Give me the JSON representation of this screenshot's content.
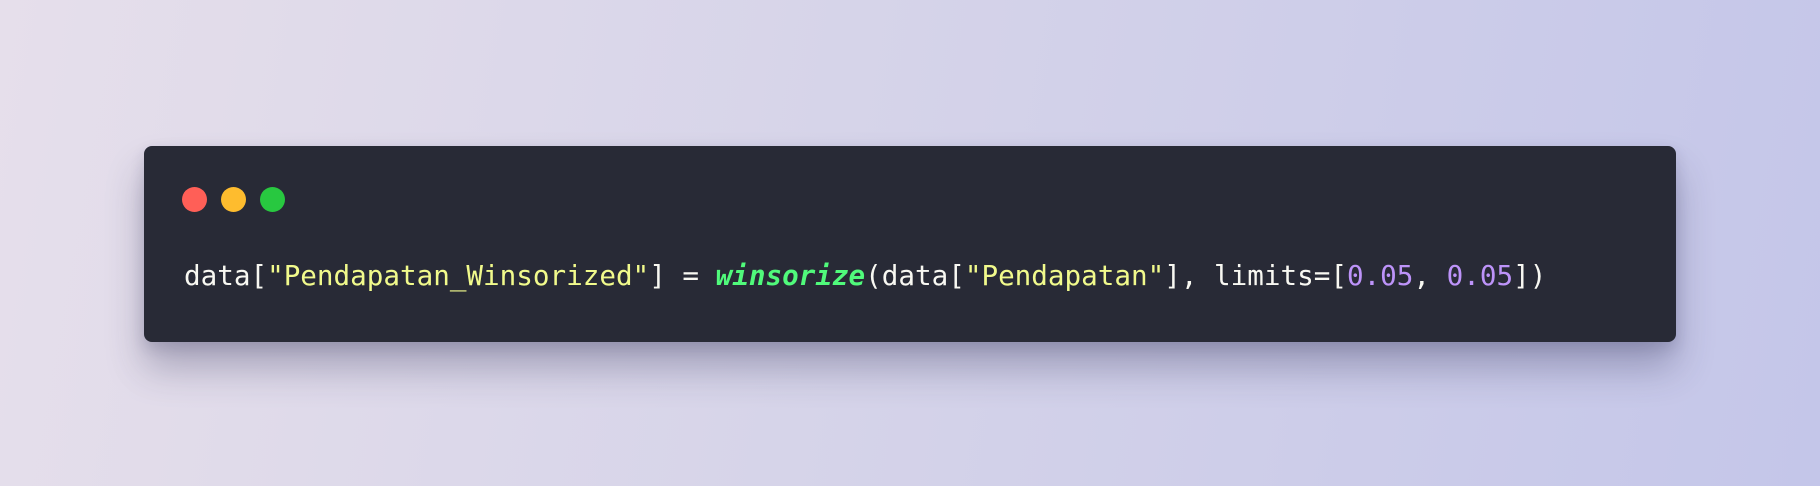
{
  "window": {
    "controls": [
      {
        "name": "close",
        "color": "#ff5f57"
      },
      {
        "name": "minimize",
        "color": "#febc2e"
      },
      {
        "name": "maximize",
        "color": "#28c840"
      }
    ]
  },
  "code": {
    "tokens": [
      {
        "text": "data[",
        "type": "plain"
      },
      {
        "text": "\"Pendapatan_Winsorized\"",
        "type": "str"
      },
      {
        "text": "] = ",
        "type": "plain"
      },
      {
        "text": "winsorize",
        "type": "fn"
      },
      {
        "text": "(data[",
        "type": "plain"
      },
      {
        "text": "\"Pendapatan\"",
        "type": "str"
      },
      {
        "text": "], limits=[",
        "type": "plain"
      },
      {
        "text": "0.05",
        "type": "num"
      },
      {
        "text": ", ",
        "type": "plain"
      },
      {
        "text": "0.05",
        "type": "num"
      },
      {
        "text": "])",
        "type": "plain"
      }
    ],
    "colors": {
      "background": "#282a36",
      "plain": "#f8f8f2",
      "string": "#f1fa8c",
      "function": "#50fa7b",
      "number": "#bd93f9"
    }
  }
}
